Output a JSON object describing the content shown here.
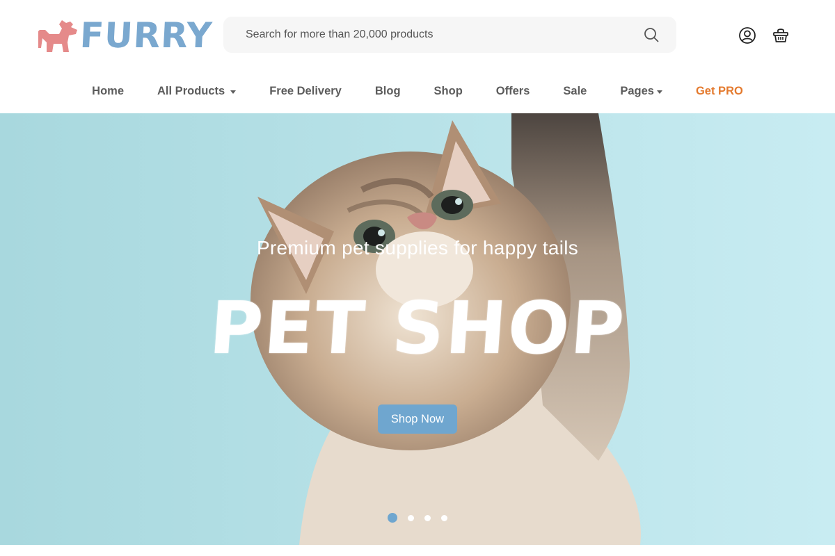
{
  "brand": {
    "name": "FURRY",
    "logo_icon": "dog-silhouette-icon",
    "colors": {
      "pink": "#e58a8a",
      "blue": "#7aa8cf"
    }
  },
  "search": {
    "placeholder": "Search for more than 20,000 products",
    "icon": "search-icon"
  },
  "header_icons": {
    "account": "user-circle-icon",
    "cart": "shopping-basket-icon"
  },
  "nav": {
    "items": [
      {
        "label": "Home",
        "dropdown": false
      },
      {
        "label": "All Products",
        "dropdown": true
      },
      {
        "label": "Free Delivery",
        "dropdown": false
      },
      {
        "label": "Blog",
        "dropdown": false
      },
      {
        "label": "Shop",
        "dropdown": false
      },
      {
        "label": "Offers",
        "dropdown": false
      },
      {
        "label": "Sale",
        "dropdown": false
      },
      {
        "label": "Pages",
        "dropdown": true
      },
      {
        "label": "Get PRO",
        "dropdown": false,
        "accent": "#e47a2e"
      }
    ]
  },
  "hero": {
    "subtitle": "Premium pet supplies for happy tails",
    "title": "PET SHOP",
    "cta_label": "Shop Now",
    "background_color": "#c4e9ef",
    "cta_color": "#6fa6cf",
    "slides_total": 4,
    "active_slide": 1
  }
}
